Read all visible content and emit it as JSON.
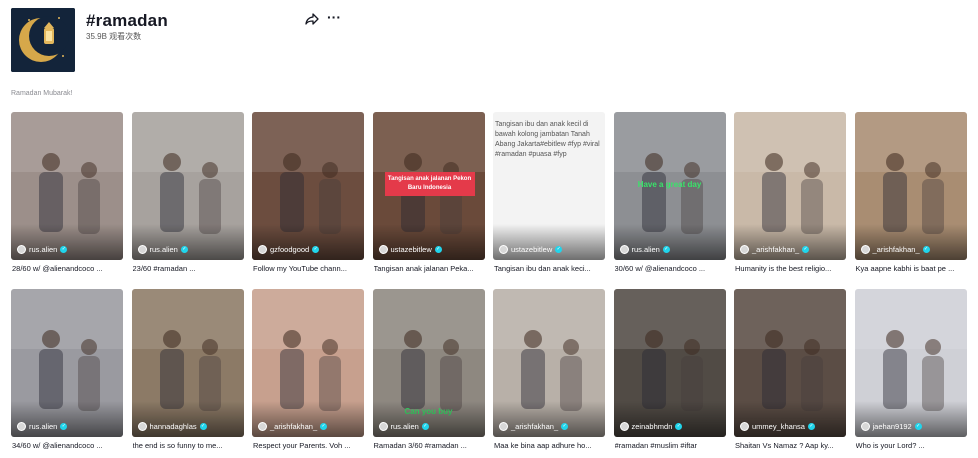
{
  "header": {
    "title": "#ramadan",
    "views": "35.9B 观看次数",
    "description": "Ramadan Mubarak!"
  },
  "videos": [
    {
      "author": "rus.alien",
      "caption": "28/60 w/ @alienandcoco ...",
      "bg": "#9c8f8a"
    },
    {
      "author": "rus.alien",
      "caption": "23/60 #ramadan ...",
      "bg": "#a7a29e"
    },
    {
      "author": "gzfoodgood",
      "caption": "Follow my YouTube chann...",
      "bg": "#6c4d3f"
    },
    {
      "author": "ustazebitlew",
      "caption": "Tangisan anak jalanan Peka...",
      "bg": "#6a4a3a",
      "overlay": "Tangisan anak jalanan Pekon Baru Indonesia"
    },
    {
      "author": "ustazebitlew",
      "caption": "Tangisan ibu dan anak keci...",
      "bg": "#f3f3f3",
      "broken_alt": "Tangisan ibu dan anak kecil di bawah kolong jambatan Tanah Abang Jakarta#ebitlew #fyp #viral #ramadan #puasa #fyp"
    },
    {
      "author": "rus.alien",
      "caption": "30/60 w/ @alienandcoco ...",
      "bg": "#8d8f93",
      "green": "Have a great day"
    },
    {
      "author": "_arishfakhan_",
      "caption": "Humanity is the best religio...",
      "bg": "#c9b9a8"
    },
    {
      "author": "_arishfakhan_",
      "caption": "Kya aapne kabhi is baat pe ...",
      "bg": "#a98d72"
    },
    {
      "author": "rus.alien",
      "caption": "34/60 w/ @alienandcoco ...",
      "bg": "#9a9aa0"
    },
    {
      "author": "hannadaghlas",
      "caption": "the end is so funny to me...",
      "bg": "#8c7a66"
    },
    {
      "author": "_arishfakhan_",
      "caption": "Respect your Parents. Voh ...",
      "bg": "#c7a08e"
    },
    {
      "author": "rus.alien",
      "caption": "Ramadan 3/60 #ramadan ...",
      "bg": "#8e8880",
      "green": "Can you buy"
    },
    {
      "author": "_arishfakhan_",
      "caption": "Maa ke bina aap adhure ho...",
      "bg": "#b8b0a8"
    },
    {
      "author": "zeinabhmdn",
      "caption": "#ramadan #muslim #iftar",
      "bg": "#514b45"
    },
    {
      "author": "ummey_khansa",
      "caption": "Shaitan Vs Namaz ? Aap ky...",
      "bg": "#5b4d45"
    },
    {
      "author": "jaehan9192",
      "caption": "Who is your Lord? ...",
      "bg": "#cfd0d6"
    }
  ]
}
